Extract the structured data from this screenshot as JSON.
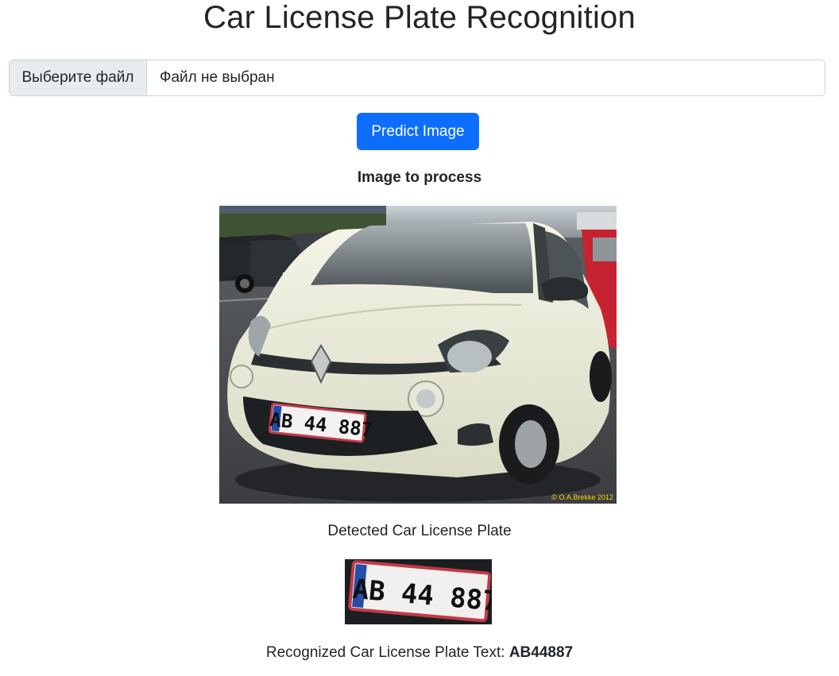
{
  "page": {
    "title": "Car License Plate Recognition"
  },
  "upload": {
    "choose_label": "Выберите файл",
    "file_status": "Файл не выбран"
  },
  "actions": {
    "predict_label": "Predict Image"
  },
  "input_section": {
    "heading": "Image to process",
    "photo_plate_text": "AB 44 887",
    "photo_credit": "© O.A.Brekke 2012"
  },
  "detection_section": {
    "heading": "Detected Car License Plate",
    "crop_plate_text": "AB 44 887"
  },
  "result": {
    "label": "Recognized Car License Plate Text:",
    "value": "AB44887"
  },
  "colors": {
    "primary": "#0d6efd",
    "text": "#212529",
    "border": "#ced4da",
    "input_button_bg": "#e9ecef",
    "car_body": "#ecedd9"
  },
  "icons": {
    "plate_country": "DK"
  }
}
